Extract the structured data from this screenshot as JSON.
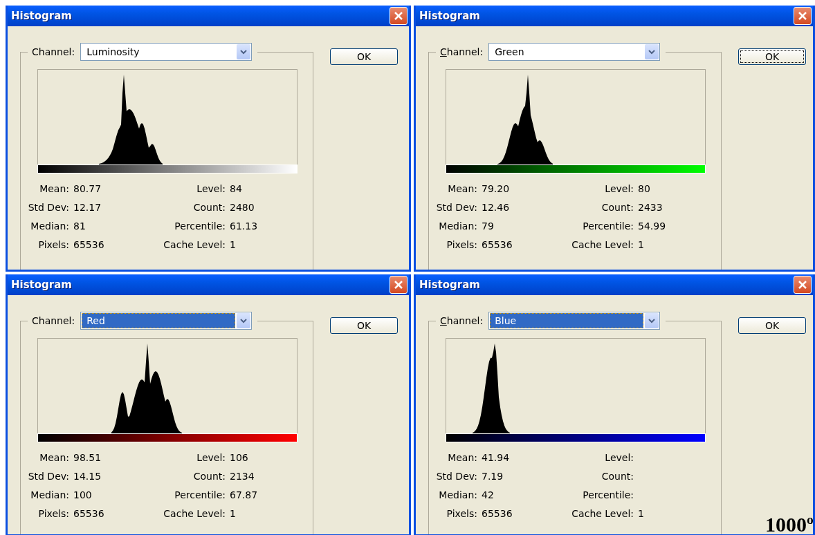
{
  "dialogs": [
    {
      "title": "Histogram",
      "channel_label": "Channel:",
      "accelerator_shown": false,
      "channel": "Luminosity",
      "channel_focused": false,
      "ok": "OK",
      "ok_focused": false,
      "color": "#ffffff",
      "stats_left": [
        {
          "label": "Mean:",
          "value": "80.77"
        },
        {
          "label": "Std Dev:",
          "value": "12.17"
        },
        {
          "label": "Median:",
          "value": "81"
        },
        {
          "label": "Pixels:",
          "value": "65536"
        }
      ],
      "stats_right": [
        {
          "label": "Level:",
          "value": "84"
        },
        {
          "label": "Count:",
          "value": "2480"
        },
        {
          "label": "Percentile:",
          "value": "61.13"
        },
        {
          "label": "Cache Level:",
          "value": "1"
        }
      ]
    },
    {
      "title": "Histogram",
      "channel_label": "Channel:",
      "accelerator_shown": true,
      "channel": "Green",
      "channel_focused": false,
      "ok": "OK",
      "ok_focused": true,
      "color": "#00ff00",
      "stats_left": [
        {
          "label": "Mean:",
          "value": "79.20"
        },
        {
          "label": "Std Dev:",
          "value": "12.46"
        },
        {
          "label": "Median:",
          "value": "79"
        },
        {
          "label": "Pixels:",
          "value": "65536"
        }
      ],
      "stats_right": [
        {
          "label": "Level:",
          "value": "80"
        },
        {
          "label": "Count:",
          "value": "2433"
        },
        {
          "label": "Percentile:",
          "value": "54.99"
        },
        {
          "label": "Cache Level:",
          "value": "1"
        }
      ]
    },
    {
      "title": "Histogram",
      "channel_label": "Channel:",
      "accelerator_shown": false,
      "channel": "Red",
      "channel_focused": true,
      "ok": "OK",
      "ok_focused": false,
      "color": "#ff0000",
      "stats_left": [
        {
          "label": "Mean:",
          "value": "98.51"
        },
        {
          "label": "Std Dev:",
          "value": "14.15"
        },
        {
          "label": "Median:",
          "value": "100"
        },
        {
          "label": "Pixels:",
          "value": "65536"
        }
      ],
      "stats_right": [
        {
          "label": "Level:",
          "value": "106"
        },
        {
          "label": "Count:",
          "value": "2134"
        },
        {
          "label": "Percentile:",
          "value": "67.87"
        },
        {
          "label": "Cache Level:",
          "value": "1"
        }
      ]
    },
    {
      "title": "Histogram",
      "channel_label": "Channel:",
      "accelerator_shown": true,
      "channel": "Blue",
      "channel_focused": true,
      "ok": "OK",
      "ok_focused": false,
      "color": "#0000ff",
      "stats_left": [
        {
          "label": "Mean:",
          "value": "41.94"
        },
        {
          "label": "Std Dev:",
          "value": "7.19"
        },
        {
          "label": "Median:",
          "value": "42"
        },
        {
          "label": "Pixels:",
          "value": "65536"
        }
      ],
      "stats_right": [
        {
          "label": "Level:"
        },
        {
          "label": "Count:"
        },
        {
          "label": "Percentile:"
        },
        {
          "label": "Cache Level:",
          "value": "1"
        }
      ]
    }
  ],
  "corner_text": "1000º"
}
